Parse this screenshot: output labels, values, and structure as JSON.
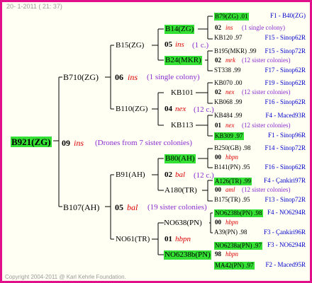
{
  "header": "20-  1-2011 ( 21: 37)",
  "footer": "Copyright 2004-2011 @ Karl Kehrle Foundation.",
  "root": {
    "id": "B921(ZG)",
    "num": "09",
    "mark": "ins",
    "note": "(Drones from 7 sister colonies)"
  },
  "g1": {
    "top": {
      "id": "B710(ZG)",
      "num": "06",
      "mark": "ins",
      "note": "(1 single colony)"
    },
    "bottom": {
      "id": "B107(AH)",
      "num": "05",
      "mark": "bal",
      "note": "(19 sister colonies)"
    }
  },
  "g2": {
    "a": {
      "id": "B15(ZG)",
      "num": "05",
      "mark": "ins",
      "note": "(1 c.)"
    },
    "b": {
      "id": "B110(ZG)",
      "num": "04",
      "mark": "nex",
      "note": "(12 c.)"
    },
    "c": {
      "id": "B91(AH)",
      "num": "02",
      "mark": "bal",
      "note": "(12 c.)"
    },
    "d": {
      "id": "NO61(TR)",
      "num": "01",
      "mark": "hbpn"
    }
  },
  "g3": {
    "a": {
      "id": "B14(ZG)"
    },
    "b": {
      "id": "B24(MKR)"
    },
    "c": {
      "id": "KB101"
    },
    "d": {
      "id": "KB113"
    },
    "e": {
      "id": "B80(AH)"
    },
    "f": {
      "id": "A180(TR)"
    },
    "g": {
      "id": "NO638(PN)"
    },
    "h": {
      "id": "NO6238b(PN)"
    }
  },
  "g4": [
    {
      "id": "B79(ZG) .01",
      "ref": "F1 - B40(ZG)"
    },
    {
      "num": "02",
      "mark": "ins",
      "note": "(1 single colony)"
    },
    {
      "id": "KB120 .97",
      "ref": "F15 - Sinop62R"
    },
    {
      "id": "B195(MKR) .99",
      "ref": "F15 - Sinop72R"
    },
    {
      "num": "02",
      "mark": "mrk",
      "note": "(12 sister colonies)"
    },
    {
      "id": "ST338 .99",
      "ref": "F17 - Sinop62R"
    },
    {
      "id": "KB070 .00",
      "ref": "F19 - Sinop62R"
    },
    {
      "num": "02",
      "mark": "nex",
      "note": "(12 sister colonies)"
    },
    {
      "id": "KB068 .99",
      "ref": "F16 - Sinop62R"
    },
    {
      "id": "KB484 .99",
      "ref": "F4 - Maced93R"
    },
    {
      "num": "01",
      "mark": "nex",
      "note": "(12 sister colonies)"
    },
    {
      "id": "KB309 .97",
      "ref": "F1 - Sinop96R"
    },
    {
      "id": "B250(GB) .98",
      "ref": "F14 - Sinop72R"
    },
    {
      "num": "00",
      "mark": "hbpn"
    },
    {
      "id": "B141(PN) .95",
      "ref": "F16 - Sinop62R"
    },
    {
      "id": "A126(TR) .99",
      "ref": "F4 - Çankiri97R"
    },
    {
      "num": "00",
      "mark": "aml",
      "note": "(12 sister colonies)"
    },
    {
      "id": "B175(TR) .95",
      "ref": "F13 - Sinop72R"
    },
    {
      "id": "NO6238b(PN) .98",
      "ref": "F4 - NO6294R"
    },
    {
      "num": "00",
      "mark": "hbpn"
    },
    {
      "id": "A39(PN) .98",
      "ref": "F3 - Çankiri96R"
    },
    {
      "id": "NO6238a(PN) .97",
      "ref": "F3 - NO6294R"
    },
    {
      "num": "98",
      "mark": "hbpn"
    },
    {
      "id": "MA42(PN) .97",
      "ref": "F2 - Maced95R"
    }
  ]
}
